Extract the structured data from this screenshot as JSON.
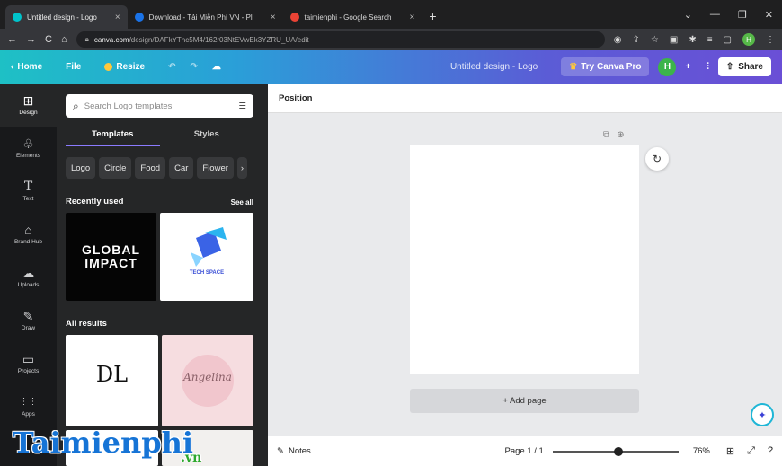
{
  "browser": {
    "tabs": [
      {
        "title": "Untitled design - Logo",
        "active": true,
        "color": "#00c4cc"
      },
      {
        "title": "Download - Tải Miễn Phí VN - Pl",
        "active": false,
        "color": "#1a73e8"
      },
      {
        "title": "taimienphi - Google Search",
        "active": false,
        "color": "#ea4335"
      }
    ],
    "url_domain": "canva.com",
    "url_path": "/design/DAFkYTnc5M4/162r03NtEVwEk3YZRU_UA/edit",
    "profile_initial": "H"
  },
  "canva_header": {
    "home": "Home",
    "file": "File",
    "resize": "Resize",
    "title": "Untitled design - Logo",
    "try_pro": "Try Canva Pro",
    "avatar_initial": "H",
    "share": "Share"
  },
  "rail": [
    {
      "label": "Design",
      "icon": "design-icon",
      "glyph": "⊞"
    },
    {
      "label": "Elements",
      "icon": "elements-icon",
      "glyph": "♧"
    },
    {
      "label": "Text",
      "icon": "text-icon",
      "glyph": "T"
    },
    {
      "label": "Brand Hub",
      "icon": "brand-hub-icon",
      "glyph": "⌂"
    },
    {
      "label": "Uploads",
      "icon": "uploads-icon",
      "glyph": "☁"
    },
    {
      "label": "Draw",
      "icon": "draw-icon",
      "glyph": "✎"
    },
    {
      "label": "Projects",
      "icon": "projects-icon",
      "glyph": "▭"
    },
    {
      "label": "Apps",
      "icon": "apps-icon",
      "glyph": "⋮⋮"
    }
  ],
  "panel": {
    "search_placeholder": "Search Logo templates",
    "tab_templates": "Templates",
    "tab_styles": "Styles",
    "chips": [
      "Logo",
      "Circle",
      "Food",
      "Car",
      "Flower"
    ],
    "recently_used": "Recently used",
    "see_all": "See all",
    "all_results": "All results",
    "thumb1_line1": "GLOBAL",
    "thumb1_line2": "IMPACT",
    "thumb2_text": "TECH SPACE",
    "thumb3_text": "DL",
    "thumb4_text": "Angelina"
  },
  "workspace": {
    "position": "Position",
    "add_page": "+ Add page",
    "notes": "Notes",
    "page": "Page 1 / 1",
    "zoom": "76%"
  },
  "watermark": {
    "main": "Taimienphi",
    "sub": ".vn"
  }
}
